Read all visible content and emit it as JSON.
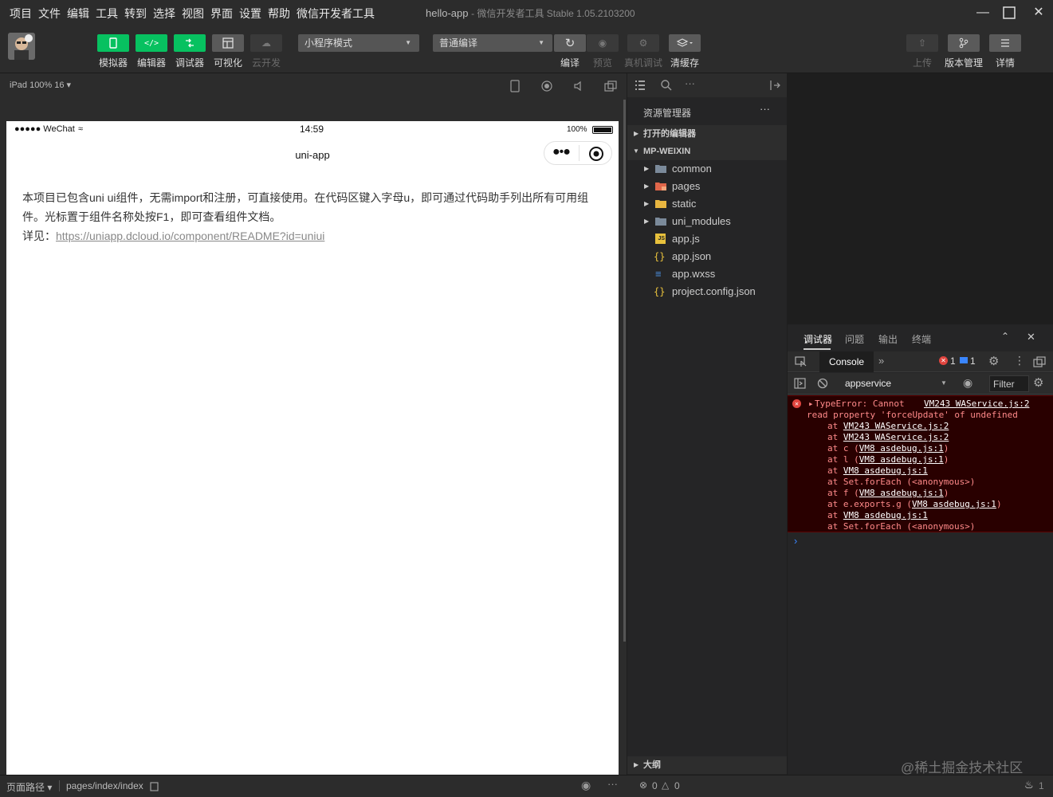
{
  "menu": [
    "项目",
    "文件",
    "编辑",
    "工具",
    "转到",
    "选择",
    "视图",
    "界面",
    "设置",
    "帮助",
    "微信开发者工具"
  ],
  "window": {
    "title": "hello-app",
    "subtitle": "- 微信开发者工具 Stable 1.05.2103200"
  },
  "toolbar": {
    "simulator": "模拟器",
    "editor": "编辑器",
    "debugger": "调试器",
    "visual": "可视化",
    "cloud": "云开发",
    "mode": "小程序模式",
    "compile_mode": "普通编译",
    "compile": "编译",
    "preview": "预览",
    "remote_debug": "真机调试",
    "clear_cache": "清缓存",
    "upload": "上传",
    "version": "版本管理",
    "details": "详情"
  },
  "sim": {
    "device": "iPad 100% 16 ▾",
    "status_left": "●●●●● WeChat",
    "time": "14:59",
    "battery": "100%",
    "nav_title": "uni-app",
    "content_line1": "本项目已包含uni ui组件，无需import和注册，可直接使用。在代码区键入字母u，即可通过代码助手列出所有可用组",
    "content_line2": "件。光标置于组件名称处按F1，即可查看组件文档。",
    "content_prefix": "详见：",
    "content_link": "https://uniapp.dcloud.io/component/README?id=uniui"
  },
  "explorer": {
    "title": "资源管理器",
    "open_editors": "打开的编辑器",
    "project": "MP-WEIXIN",
    "items": [
      {
        "name": "common",
        "type": "folder"
      },
      {
        "name": "pages",
        "type": "folder-pages"
      },
      {
        "name": "static",
        "type": "folder-static"
      },
      {
        "name": "uni_modules",
        "type": "folder"
      },
      {
        "name": "app.js",
        "type": "js"
      },
      {
        "name": "app.json",
        "type": "json"
      },
      {
        "name": "app.wxss",
        "type": "css"
      },
      {
        "name": "project.config.json",
        "type": "json"
      }
    ],
    "outline": "大纲"
  },
  "debug": {
    "tabs": [
      "调试器",
      "问题",
      "输出",
      "终端"
    ],
    "console_tab": "Console",
    "error_count": "1",
    "info_count": "1",
    "context": "appservice",
    "filter": "Filter",
    "error": {
      "msg1": "TypeError: Cannot",
      "source": "VM243 WAService.js:2",
      "msg2": "read property 'forceUpdate' of undefined",
      "stack": [
        {
          "pre": "at ",
          "fn": "",
          "link": "VM243 WAService.js:2",
          "post": ""
        },
        {
          "pre": "at ",
          "fn": "",
          "link": "VM243 WAService.js:2",
          "post": ""
        },
        {
          "pre": "at c (",
          "fn": "",
          "link": "VM8 asdebug.js:1",
          "post": ")"
        },
        {
          "pre": "at l (",
          "fn": "",
          "link": "VM8 asdebug.js:1",
          "post": ")"
        },
        {
          "pre": "at ",
          "fn": "",
          "link": "VM8 asdebug.js:1",
          "post": ""
        },
        {
          "pre": "at Set.forEach (<anonymous>)",
          "fn": "",
          "link": "",
          "post": ""
        },
        {
          "pre": "at f (",
          "fn": "",
          "link": "VM8 asdebug.js:1",
          "post": ")"
        },
        {
          "pre": "at e.exports.g (",
          "fn": "",
          "link": "VM8 asdebug.js:1",
          "post": ")"
        },
        {
          "pre": "at ",
          "fn": "",
          "link": "VM8 asdebug.js:1",
          "post": ""
        },
        {
          "pre": "at Set.forEach (<anonymous>)",
          "fn": "",
          "link": "",
          "post": ""
        }
      ]
    }
  },
  "bottom": {
    "page_path_label": "页面路径 ▾",
    "page_path": "pages/index/index",
    "errors": "0",
    "warnings": "0",
    "notify": "1",
    "watermark": "@稀土掘金技术社区"
  }
}
